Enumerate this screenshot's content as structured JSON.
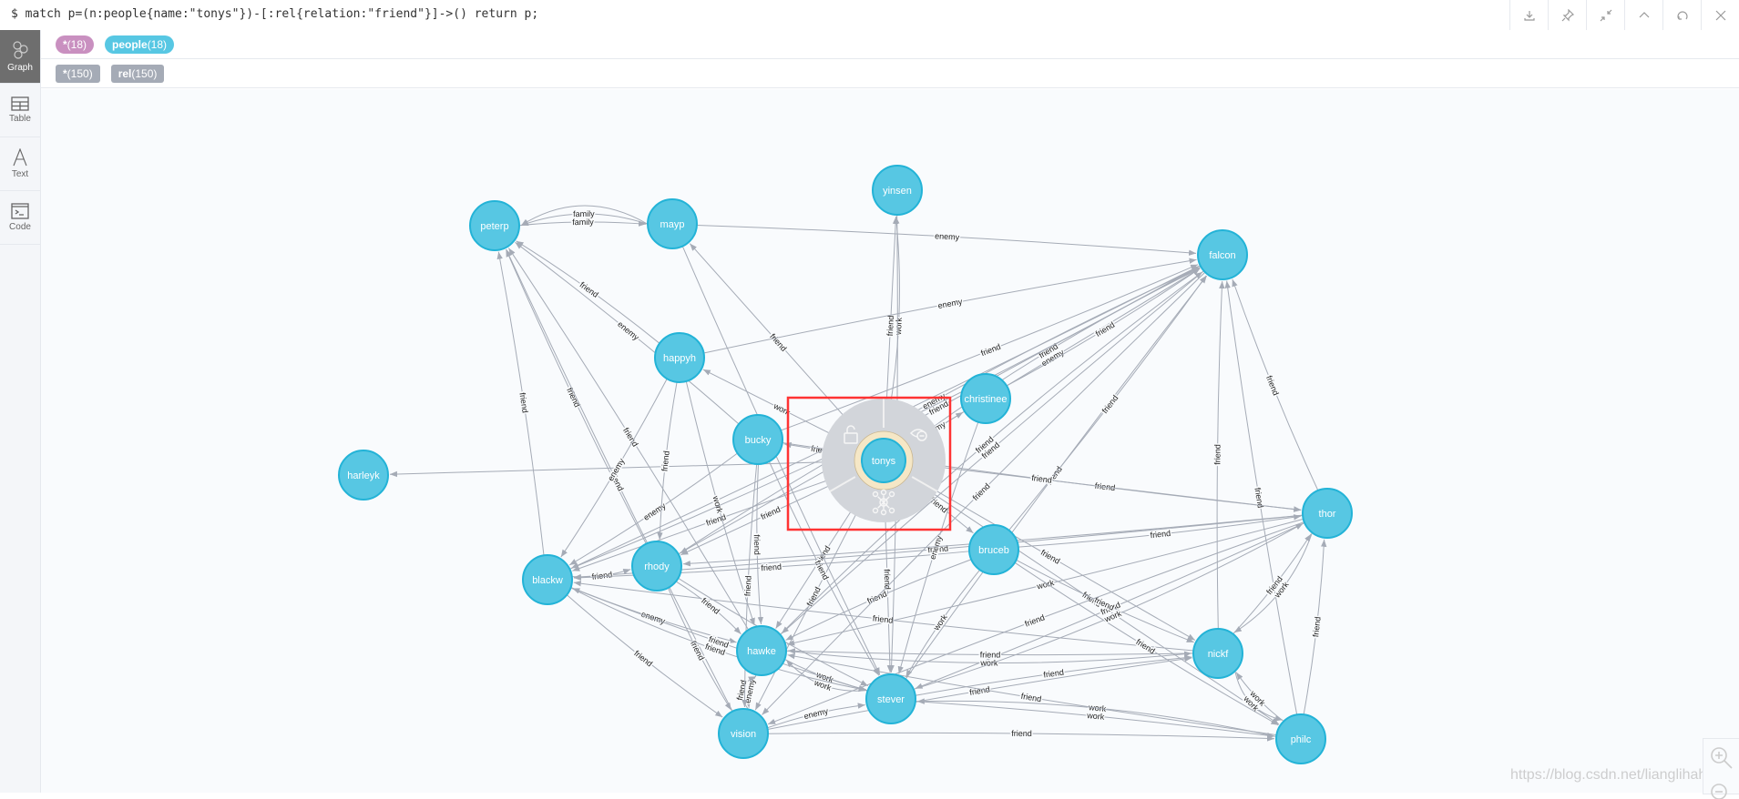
{
  "query": "$ match p=(n:people{name:\"tonys\"})-[:rel{relation:\"friend\"}]->() return p;",
  "toolbar": [
    {
      "icon": "download-icon"
    },
    {
      "icon": "pin-icon"
    },
    {
      "icon": "collapse-icon"
    },
    {
      "icon": "chevron-up-icon"
    },
    {
      "icon": "rerun-icon"
    },
    {
      "icon": "close-icon"
    }
  ],
  "sidebar": {
    "items": [
      {
        "label": "Graph",
        "icon": "graph-icon",
        "active": true
      },
      {
        "label": "Table",
        "icon": "table-icon"
      },
      {
        "label": "Text",
        "icon": "text-icon"
      },
      {
        "label": "Code",
        "icon": "code-icon"
      }
    ]
  },
  "node_labels": [
    {
      "name": "*",
      "count": "(18)",
      "color": "#c990c0"
    },
    {
      "name": "people",
      "count": "(18)",
      "color": "#57c7e3"
    }
  ],
  "rel_types": [
    {
      "name": "*",
      "count": "(150)",
      "color": "#a5abb6"
    },
    {
      "name": "rel",
      "count": "(150)",
      "color": "#a5abb6"
    }
  ],
  "colors": {
    "node_fill": "#57c7e3",
    "node_border": "#23b3d7",
    "edge": "#a5abb6",
    "selection": "#ff3333"
  },
  "selected_node": "tonys",
  "nodes": [
    "peterp",
    "mayp",
    "yinsen",
    "falcon",
    "happyh",
    "christinee",
    "harleyk",
    "bucky",
    "tonys",
    "thor",
    "bruceb",
    "rhody",
    "blackw",
    "hawke",
    "nickf",
    "stever",
    "vision",
    "philc"
  ],
  "edges": [
    [
      "peterp",
      "mayp",
      "family"
    ],
    [
      "mayp",
      "peterp",
      "family"
    ],
    [
      "mayp",
      "peterp",
      ""
    ],
    [
      "mayp",
      "falcon",
      "enemy"
    ],
    [
      "happyh",
      "peterp",
      "friend"
    ],
    [
      "bucky",
      "peterp",
      "enemy"
    ],
    [
      "tonys",
      "mayp",
      "friend"
    ],
    [
      "tonys",
      "yinsen",
      "friend"
    ],
    [
      "tonys",
      "yinsen",
      "work"
    ],
    [
      "tonys",
      "falcon",
      "enemy"
    ],
    [
      "tonys",
      "falcon",
      "friend"
    ],
    [
      "tonys",
      "happyh",
      "work"
    ],
    [
      "tonys",
      "christinee",
      "enemy"
    ],
    [
      "tonys",
      "harleyk",
      ""
    ],
    [
      "tonys",
      "thor",
      "friend"
    ],
    [
      "tonys",
      "bruceb",
      "friend"
    ],
    [
      "tonys",
      "stever",
      "friend"
    ],
    [
      "tonys",
      "hawke",
      "friend"
    ],
    [
      "tonys",
      "vision",
      "friend"
    ],
    [
      "tonys",
      "nickf",
      "friend"
    ],
    [
      "tonys",
      "blackw",
      "friend"
    ],
    [
      "tonys",
      "rhody",
      "friend"
    ],
    [
      "tonys",
      "philc",
      "friend"
    ],
    [
      "tonys",
      "bucky",
      "friend"
    ],
    [
      "blackw",
      "peterp",
      "friend"
    ],
    [
      "rhody",
      "peterp",
      "friend"
    ],
    [
      "hawke",
      "peterp",
      "friend"
    ],
    [
      "vision",
      "peterp",
      "friend"
    ],
    [
      "stever",
      "falcon",
      "friend"
    ],
    [
      "bruceb",
      "falcon",
      "friend"
    ],
    [
      "thor",
      "falcon",
      "friend"
    ],
    [
      "nickf",
      "falcon",
      "friend"
    ],
    [
      "philc",
      "falcon",
      "friend"
    ],
    [
      "thor",
      "blackw",
      "friend"
    ],
    [
      "thor",
      "stever",
      "friend"
    ],
    [
      "thor",
      "hawke",
      "work"
    ],
    [
      "nickf",
      "blackw",
      "friend"
    ],
    [
      "nickf",
      "thor",
      "friend"
    ],
    [
      "philc",
      "thor",
      "friend"
    ],
    [
      "philc",
      "nickf",
      "work"
    ],
    [
      "nickf",
      "philc",
      "work"
    ],
    [
      "stever",
      "philc",
      "work"
    ],
    [
      "stever",
      "nickf",
      "friend"
    ],
    [
      "hawke",
      "stever",
      "work"
    ],
    [
      "stever",
      "hawke",
      "work"
    ],
    [
      "vision",
      "stever",
      "enemy"
    ],
    [
      "blackw",
      "vision",
      "friend"
    ],
    [
      "blackw",
      "hawke",
      "enemy"
    ],
    [
      "rhody",
      "hawke",
      "friend"
    ],
    [
      "rhody",
      "vision",
      "friend"
    ],
    [
      "blackw",
      "rhody",
      "friend"
    ],
    [
      "bucky",
      "blackw",
      "enemy"
    ],
    [
      "bucky",
      "hawke",
      "friend"
    ],
    [
      "bucky",
      "stever",
      "friend"
    ],
    [
      "happyh",
      "blackw",
      "enemy"
    ],
    [
      "happyh",
      "rhody",
      "friend"
    ],
    [
      "hawke",
      "vision",
      "enemy"
    ],
    [
      "vision",
      "nickf",
      "friend"
    ],
    [
      "bruceb",
      "nickf",
      "friend"
    ],
    [
      "bruceb",
      "philc",
      "friend"
    ],
    [
      "bruceb",
      "stever",
      "work"
    ],
    [
      "bruceb",
      "hawke",
      "friend"
    ],
    [
      "bruceb",
      "blackw",
      "friend"
    ],
    [
      "christinee",
      "falcon",
      "friend"
    ],
    [
      "christinee",
      "stever",
      "enemy"
    ],
    [
      "falcon",
      "blackw",
      "friend"
    ],
    [
      "falcon",
      "hawke",
      "friend"
    ],
    [
      "falcon",
      "rhody",
      "friend"
    ],
    [
      "falcon",
      "vision",
      "friend"
    ],
    [
      "thor",
      "vision",
      "friend"
    ],
    [
      "thor",
      "rhody",
      "friend"
    ],
    [
      "stever",
      "blackw",
      "friend"
    ],
    [
      "vision",
      "hawke",
      "friend"
    ],
    [
      "blackw",
      "stever",
      "friend"
    ],
    [
      "happyh",
      "hawke",
      "work"
    ],
    [
      "bucky",
      "vision",
      "friend"
    ],
    [
      "rhody",
      "stever",
      "friend"
    ],
    [
      "nickf",
      "hawke",
      "friend"
    ],
    [
      "philc",
      "stever",
      "work"
    ],
    [
      "philc",
      "hawke",
      "friend"
    ],
    [
      "thor",
      "nickf",
      "work"
    ],
    [
      "mayp",
      "stever",
      ""
    ],
    [
      "yinsen",
      "stever",
      ""
    ],
    [
      "happyh",
      "falcon",
      "enemy"
    ],
    [
      "bucky",
      "falcon",
      "friend"
    ],
    [
      "bucky",
      "thor",
      "friend"
    ],
    [
      "rhody",
      "falcon",
      "enemy"
    ],
    [
      "hawke",
      "falcon",
      "friend"
    ],
    [
      "blackw",
      "falcon",
      "friend"
    ],
    [
      "bruceb",
      "thor",
      "friend"
    ],
    [
      "vision",
      "philc",
      "friend"
    ],
    [
      "hawke",
      "nickf",
      "work"
    ],
    [
      "stever",
      "thor",
      "work"
    ]
  ],
  "zoom_controls": [
    {
      "icon": "zoom-in-icon"
    },
    {
      "icon": "zoom-out-icon"
    }
  ],
  "watermark": "https://blog.csdn.net/lianglihahaha"
}
